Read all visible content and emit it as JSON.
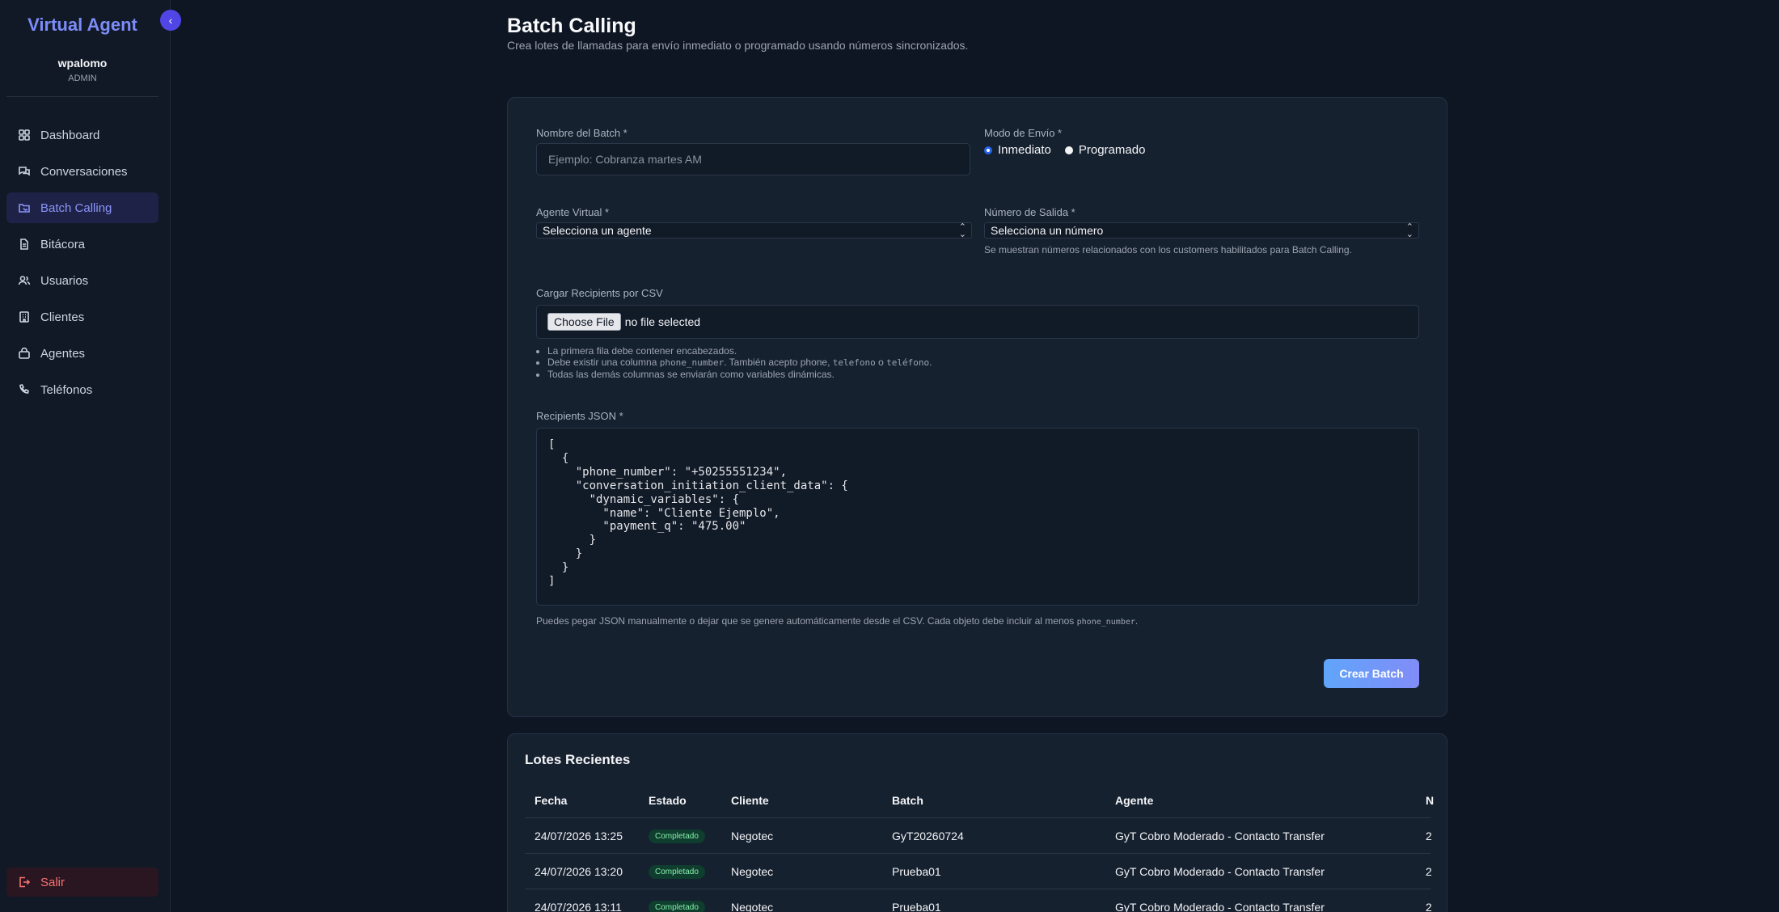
{
  "sidebar": {
    "brand": "Virtual Agent",
    "user": {
      "name": "wpalomo",
      "role": "ADMIN"
    },
    "items": [
      {
        "label": "Dashboard",
        "icon": "grid-icon"
      },
      {
        "label": "Conversaciones",
        "icon": "chat-icon"
      },
      {
        "label": "Batch Calling",
        "icon": "folder-phone-icon",
        "active": true
      },
      {
        "label": "Bitácora",
        "icon": "document-icon"
      },
      {
        "label": "Usuarios",
        "icon": "users-icon"
      },
      {
        "label": "Clientes",
        "icon": "building-icon"
      },
      {
        "label": "Agentes",
        "icon": "bag-icon"
      },
      {
        "label": "Teléfonos",
        "icon": "phone-icon"
      }
    ],
    "logout": "Salir"
  },
  "header": {
    "title": "Batch Calling",
    "subtitle": "Crea lotes de llamadas para envío inmediato o programado usando números sincronizados."
  },
  "form": {
    "batch_name_label": "Nombre del Batch *",
    "batch_name_placeholder": "Ejemplo: Cobranza martes AM",
    "mode_label": "Modo de Envío *",
    "mode_options": [
      "Inmediato",
      "Programado"
    ],
    "mode_selected": "Inmediato",
    "agent_label": "Agente Virtual *",
    "agent_value": "Selecciona un agente",
    "number_label": "Número de Salida *",
    "number_value": "Selecciona un número",
    "number_hint": "Se muestran números relacionados con los customers habilitados para Batch Calling.",
    "csv_label": "Cargar Recipients por CSV",
    "file_button": "Choose File",
    "file_status": "no file selected",
    "csv_hints": {
      "line1": "La primera fila debe contener encabezados.",
      "line2_a": "Debe existir una columna ",
      "line2_code1": "phone_number",
      "line2_b": ". También acepto phone, ",
      "line2_code2": "telefono",
      "line2_c": " o ",
      "line2_code3": "teléfono",
      "line2_d": ".",
      "line3": "Todas las demás columnas se enviarán como variables dinámicas."
    },
    "json_label": "Recipients JSON *",
    "json_value": "[\n  {\n    \"phone_number\": \"+50255551234\",\n    \"conversation_initiation_client_data\": {\n      \"dynamic_variables\": {\n        \"name\": \"Cliente Ejemplo\",\n        \"payment_q\": \"475.00\"\n      }\n    }\n  }\n]",
    "json_hint_a": "Puedes pegar JSON manualmente o dejar que se genere automáticamente desde el CSV. Cada objeto debe incluir al menos ",
    "json_hint_code": "phone_number",
    "json_hint_b": ".",
    "submit": "Crear Batch"
  },
  "recent": {
    "title": "Lotes Recientes",
    "columns": [
      "Fecha",
      "Estado",
      "Cliente",
      "Batch",
      "Agente",
      "N"
    ],
    "rows": [
      {
        "fecha": "24/07/2026 13:25",
        "estado": "Completado",
        "cliente": "Negotec",
        "batch": "GyT20260724",
        "agente": "GyT Cobro Moderado - Contacto Transfer",
        "extra": "2"
      },
      {
        "fecha": "24/07/2026 13:20",
        "estado": "Completado",
        "cliente": "Negotec",
        "batch": "Prueba01",
        "agente": "GyT Cobro Moderado - Contacto Transfer",
        "extra": "2"
      },
      {
        "fecha": "24/07/2026 13:11",
        "estado": "Completado",
        "cliente": "Negotec",
        "batch": "Prueba01",
        "agente": "GyT Cobro Moderado - Contacto Transfer",
        "extra": "2"
      }
    ]
  },
  "colors": {
    "accent": "#818cf8",
    "brand": "#7c8cf8",
    "danger": "#f87171",
    "success": "#86efac"
  }
}
